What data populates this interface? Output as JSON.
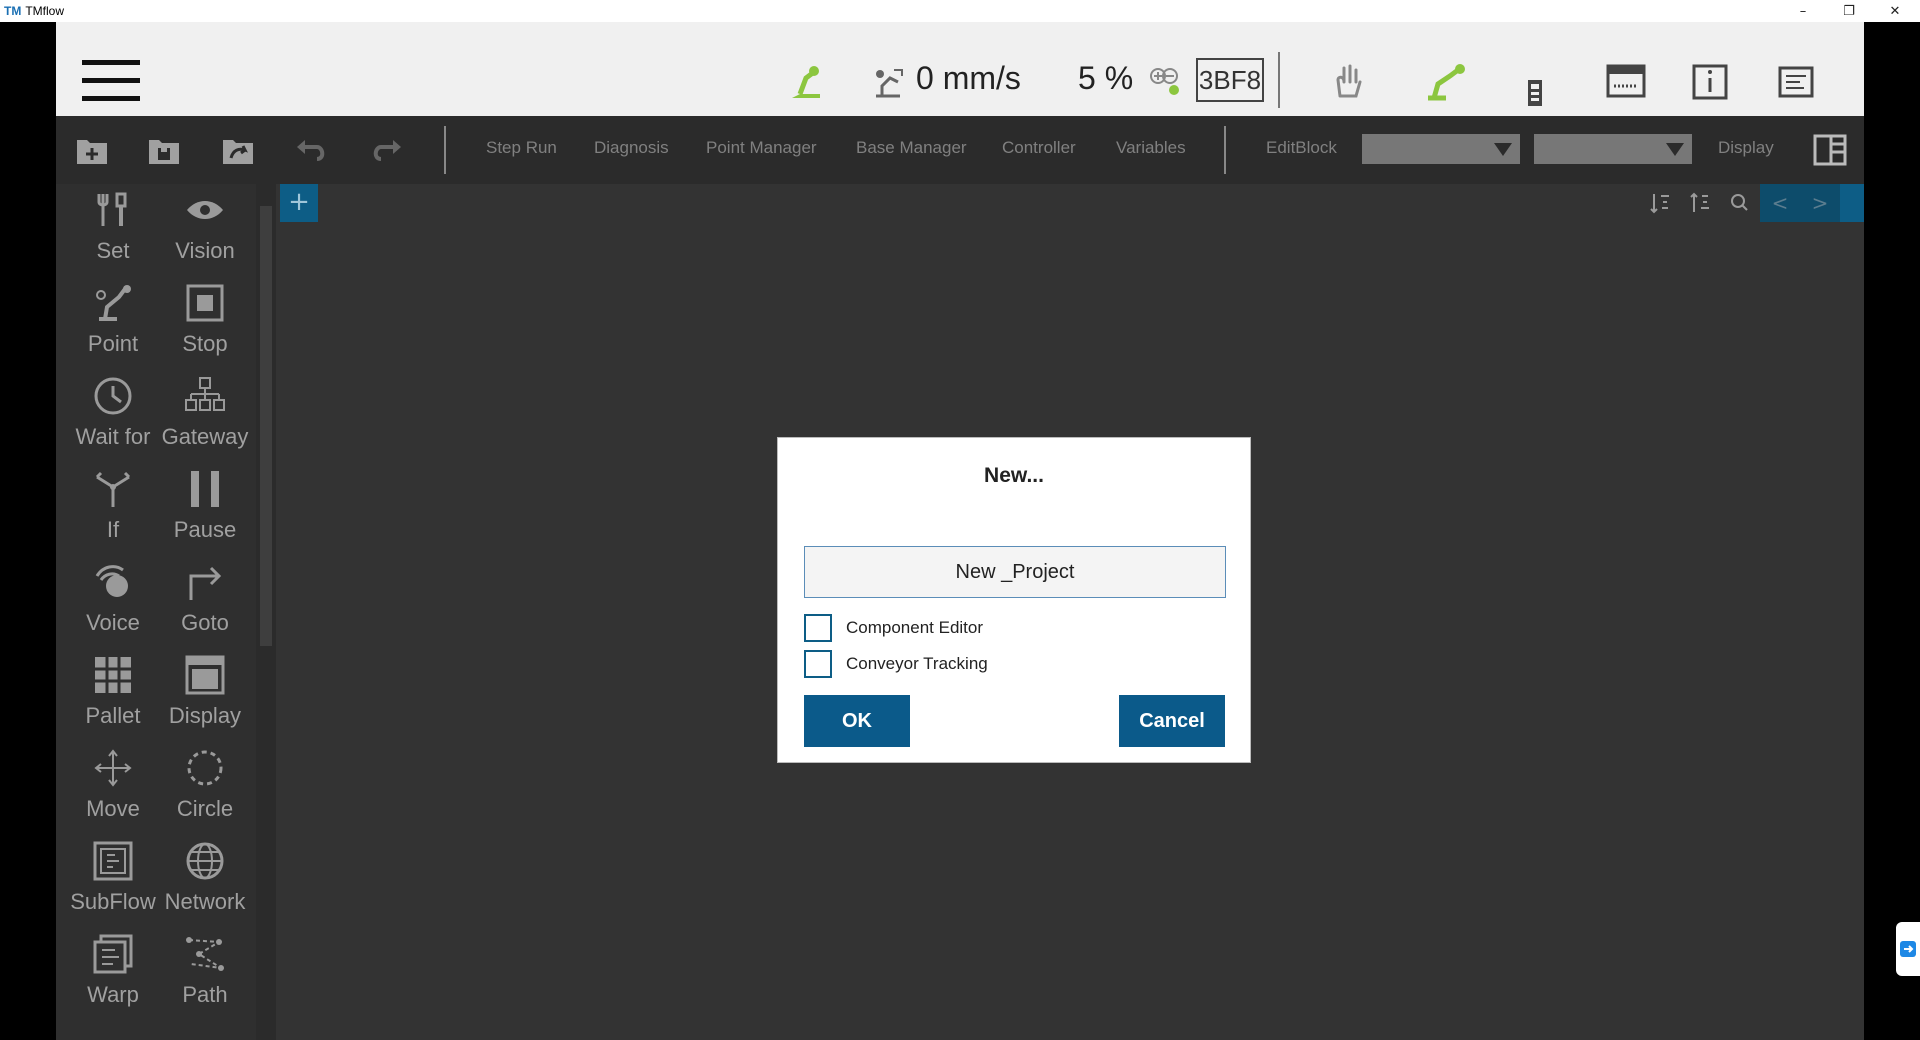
{
  "window": {
    "logo": "TM",
    "title": "TMflow",
    "minimize": "–",
    "restore": "❐",
    "close": "✕"
  },
  "status": {
    "speed": "0 mm/s",
    "percent": "5 %",
    "code": "3BF8"
  },
  "toolbar": {
    "menu": [
      "Step Run",
      "Diagnosis",
      "Point Manager",
      "Base Manager",
      "Controller",
      "Variables"
    ],
    "editblock": "EditBlock",
    "display": "Display"
  },
  "palette": {
    "items": [
      {
        "label": "Set",
        "icon": "wrench-icon"
      },
      {
        "label": "Vision",
        "icon": "eye-icon"
      },
      {
        "label": "Point",
        "icon": "robot-arm-icon"
      },
      {
        "label": "Stop",
        "icon": "stop-icon"
      },
      {
        "label": "Wait for",
        "icon": "clock-icon"
      },
      {
        "label": "Gateway",
        "icon": "hierarchy-icon"
      },
      {
        "label": "If",
        "icon": "branch-icon"
      },
      {
        "label": "Pause",
        "icon": "pause-icon"
      },
      {
        "label": "Voice",
        "icon": "speaker-icon"
      },
      {
        "label": "Goto",
        "icon": "turn-right-icon"
      },
      {
        "label": "Pallet",
        "icon": "grid-icon"
      },
      {
        "label": "Display",
        "icon": "monitor-icon"
      },
      {
        "label": "Move",
        "icon": "move-arrows-icon"
      },
      {
        "label": "Circle",
        "icon": "dashed-circle-icon"
      },
      {
        "label": "SubFlow",
        "icon": "subflow-icon"
      },
      {
        "label": "Network",
        "icon": "globe-icon"
      },
      {
        "label": "Warp",
        "icon": "warp-icon"
      },
      {
        "label": "Path",
        "icon": "path-icon"
      }
    ]
  },
  "canvas": {
    "add_tab": "+",
    "prev": "<",
    "next": ">"
  },
  "dialog": {
    "title": "New...",
    "input_value": "New _Project",
    "checkboxes": [
      {
        "label": "Component Editor",
        "checked": false
      },
      {
        "label": "Conveyor Tracking",
        "checked": false
      }
    ],
    "ok": "OK",
    "cancel": "Cancel"
  },
  "colors": {
    "accent": "#0b5a8a",
    "status_green": "#8cc63f",
    "background": "#333333"
  }
}
